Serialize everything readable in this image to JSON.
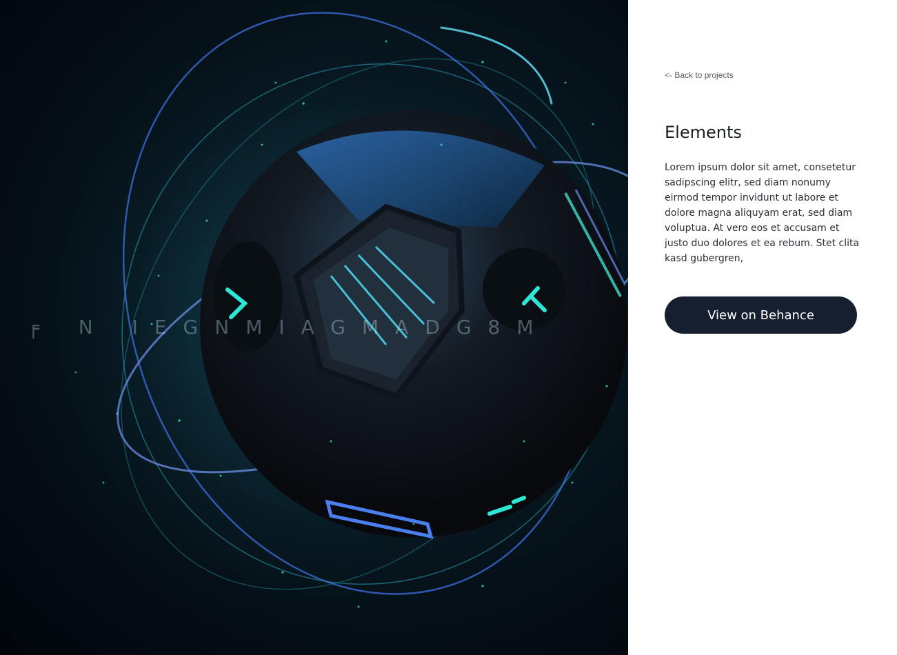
{
  "hero": {
    "alt": "3D rendered dark sphere with glowing cyan panels and orbit rings",
    "overlay_text": "╒ N  IEGNMIAGMADG8M",
    "accent_color": "#2ee6d6",
    "ring_color": "#3f6fd8"
  },
  "sidebar": {
    "back_link": "<- Back to projects",
    "title": "Elements",
    "description": "Lorem ipsum dolor sit amet, consetetur sadipscing elitr, sed diam nonumy eirmod tempor invidunt ut labore et dolore magna aliquyam erat, sed diam voluptua. At vero eos et accusam et justo duo dolores et ea rebum. Stet clita kasd gubergren,",
    "cta_label": "View on Behance",
    "cta_color": "#151f30"
  }
}
